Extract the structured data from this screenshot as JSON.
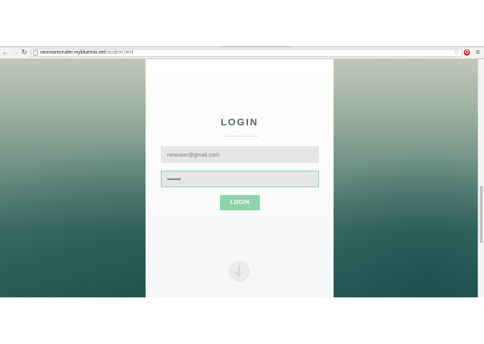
{
  "browser": {
    "nav": {
      "back_icon": "back-arrow-icon",
      "forward_icon": "forward-arrow-icon",
      "reload_icon": "reload-icon"
    },
    "url": {
      "host": "nexmorecruiter.mybluemix.net",
      "path": "/student.html"
    },
    "star_icon": "star-icon",
    "extension_icon": "opera-icon",
    "menu_icon": "hamburger-menu-icon"
  },
  "page": {
    "heading": "LOGIN",
    "email": {
      "value": "newuser@gmail.com",
      "placeholder": "newuser@gmail.com"
    },
    "password": {
      "value": "•••••••"
    },
    "login_button": "LOGIN",
    "scroll_down_icon": "down-arrow-icon"
  },
  "colors": {
    "accent": "#8fd3ac",
    "heading": "#5c6566",
    "background_dark": "#2b5b57"
  }
}
